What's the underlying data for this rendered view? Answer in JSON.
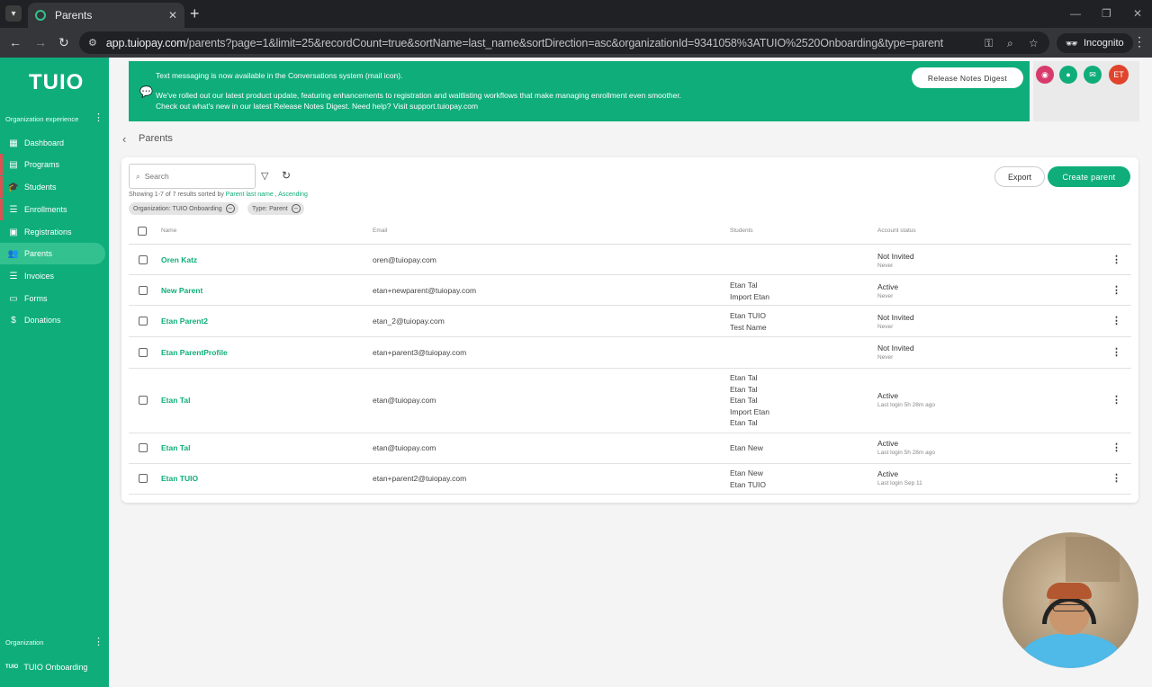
{
  "browser": {
    "tab_title": "Parents",
    "url_host": "app.tuiopay.com",
    "url_path": "/parents?page=1&limit=25&recordCount=true&sortName=last_name&sortDirection=asc&organizationId=9341058%3ATUIO%2520Onboarding&type=parent",
    "incognito_label": "Incognito"
  },
  "sidebar": {
    "logo": "TUIO",
    "section_label": "Organization experience",
    "items": [
      {
        "label": "Dashboard",
        "icon": "dashboard-icon"
      },
      {
        "label": "Programs",
        "icon": "programs-icon"
      },
      {
        "label": "Students",
        "icon": "students-icon"
      },
      {
        "label": "Enrollments",
        "icon": "enrollments-icon"
      },
      {
        "label": "Registrations",
        "icon": "registrations-icon"
      },
      {
        "label": "Parents",
        "icon": "parents-icon"
      },
      {
        "label": "Invoices",
        "icon": "invoices-icon"
      },
      {
        "label": "Forms",
        "icon": "forms-icon"
      },
      {
        "label": "Donations",
        "icon": "dollar-icon"
      }
    ],
    "active_item": "Parents",
    "org_label": "Organization",
    "org_logo_text": "TUIO",
    "org_name": "TUIO Onboarding"
  },
  "banner": {
    "line1": "Text messaging is now available in the Conversations system (mail icon).",
    "line2": "We've rolled out our latest product update, featuring enhancements to registration and waitlisting workflows that make managing enrollment even smoother.",
    "line3": "Check out what's new in our latest Release Notes Digest. Need help? Visit support.tuiopay.com",
    "button_label": "Release Notes Digest"
  },
  "header_icons": {
    "avatar_initials": "ET",
    "colors": {
      "alert": "#d83a6b",
      "chat": "#0fad7a",
      "mail": "#0fad7a",
      "avatar": "#e0442c"
    }
  },
  "page": {
    "title": "Parents",
    "search_placeholder": "Search",
    "summary_prefix": "Showing 1-7 of 7 results sorted by",
    "summary_sort_field": "Parent last name",
    "summary_sort_dir": "Ascending",
    "chips": [
      "Organization: TUIO Onboarding",
      "Type: Parent"
    ],
    "export_label": "Export",
    "create_label": "Create parent"
  },
  "table": {
    "columns": [
      "Name",
      "Email",
      "Students",
      "Account status"
    ],
    "rows": [
      {
        "name": "Oren Katz",
        "email": "oren@tuiopay.com",
        "students": [],
        "status": "Not Invited",
        "last_login": "Never"
      },
      {
        "name": "New Parent",
        "email": "etan+newparent@tuiopay.com",
        "students": [
          "Etan Tal",
          "Import Etan"
        ],
        "status": "Active",
        "last_login": "Never"
      },
      {
        "name": "Etan Parent2",
        "email": "etan_2@tuiopay.com",
        "students": [
          "Etan TUIO",
          "Test Name"
        ],
        "status": "Not Invited",
        "last_login": "Never"
      },
      {
        "name": "Etan ParentProfile",
        "email": "etan+parent3@tuiopay.com",
        "students": [],
        "status": "Not Invited",
        "last_login": "Never"
      },
      {
        "name": "Etan Tal",
        "email": "etan@tuiopay.com",
        "students": [
          "Etan Tal",
          "Etan Tal",
          "Etan Tal",
          "Import Etan",
          "Etan Tal"
        ],
        "status": "Active",
        "last_login": "Last login 5h 28m ago"
      },
      {
        "name": "Etan Tal",
        "email": "etan@tuiopay.com",
        "students": [
          "Etan New"
        ],
        "status": "Active",
        "last_login": "Last login 5h 28m ago"
      },
      {
        "name": "Etan TUIO",
        "email": "etan+parent2@tuiopay.com",
        "students": [
          "Etan New",
          "Etan TUIO"
        ],
        "status": "Active",
        "last_login": "Last login Sep 11"
      }
    ]
  },
  "theme": {
    "accent": "#0fad7a"
  }
}
